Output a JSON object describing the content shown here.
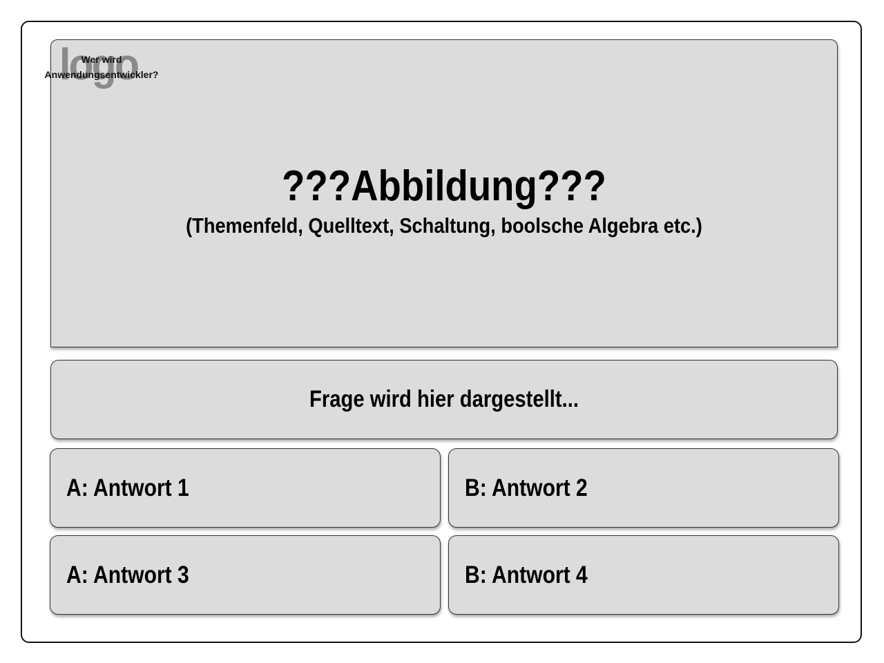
{
  "logo": {
    "text": "logo",
    "caption_line1": "Wer wird",
    "caption_line2": "Anwendungsentwickler?"
  },
  "image_panel": {
    "title": "???Abbildung???",
    "subtitle": "(Themenfeld, Quelltext, Schaltung, boolsche Algebra etc.)"
  },
  "question": {
    "text": "Frage wird hier dargestellt..."
  },
  "answers": [
    {
      "label": "A: Antwort 1"
    },
    {
      "label": "B: Antwort 2"
    },
    {
      "label": "A: Antwort 3"
    },
    {
      "label": "B: Antwort 4"
    }
  ],
  "colors": {
    "panel_background": "#dcdcdc",
    "border": "#333333",
    "logo_gray": "#8a8a8a",
    "text": "#000000"
  }
}
